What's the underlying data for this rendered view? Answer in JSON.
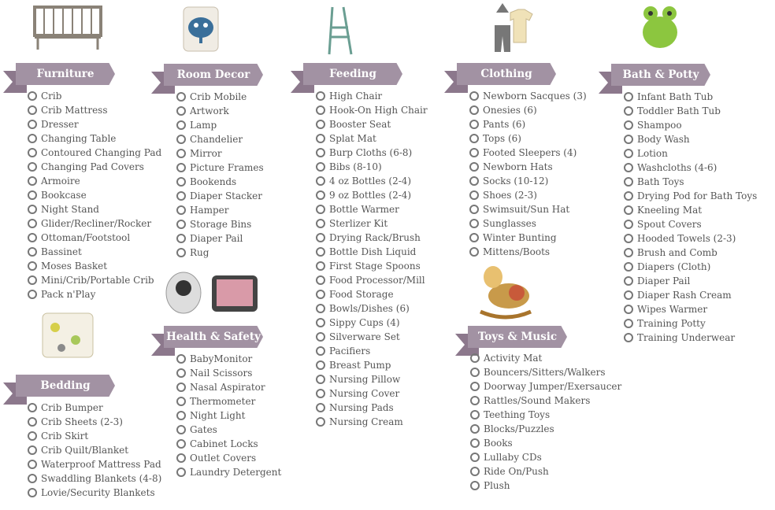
{
  "sections": [
    {
      "title": "Furniture",
      "items": [
        "Crib",
        "Crib Mattress",
        "Dresser",
        "Changing Table",
        "Contoured Changing Pad",
        "Changing Pad Covers",
        "Armoire",
        "Bookcase",
        "Night Stand",
        "Glider/Recliner/Rocker",
        "Ottoman/Footstool",
        "Bassinet",
        "Moses Basket",
        "Mini/Crib/Portable Crib",
        "Pack n'Play"
      ]
    },
    {
      "title": "Room Decor",
      "items": [
        "Crib Mobile",
        "Artwork",
        "Lamp",
        "Chandelier",
        "Mirror",
        "Picture Frames",
        "Bookends",
        "Diaper Stacker",
        "Hamper",
        "Storage Bins",
        "Diaper Pail",
        "Rug"
      ]
    },
    {
      "title": "Feeding",
      "items": [
        "High Chair",
        "Hook-On High Chair",
        "Booster Seat",
        "Splat Mat",
        "Burp Cloths (6-8)",
        "Bibs (8-10)",
        "4 oz Bottles (2-4)",
        "9 oz Bottles (2-4)",
        "Bottle Warmer",
        "Sterlizer Kit",
        "Drying Rack/Brush",
        "Bottle Dish Liquid",
        "First Stage Spoons",
        "Food Processor/Mill",
        "Food Storage",
        "Bowls/Dishes (6)",
        "Sippy Cups (4)",
        "Silverware Set",
        "Pacifiers",
        "Breast Pump",
        "Nursing Pillow",
        "Nursing Cover",
        "Nursing Pads",
        "Nursing Cream"
      ]
    },
    {
      "title": "Clothing",
      "items": [
        "Newborn Sacques (3)",
        "Onesies (6)",
        "Pants (6)",
        "Tops (6)",
        "Footed Sleepers (4)",
        "Newborn Hats",
        "Socks (10-12)",
        "Shoes (2-3)",
        "Swimsuit/Sun Hat",
        "Sunglasses",
        "Winter Bunting",
        "Mittens/Boots"
      ]
    },
    {
      "title": "Bath & Potty",
      "items": [
        "Infant Bath Tub",
        "Toddler Bath Tub",
        "Shampoo",
        "Body Wash",
        "Lotion",
        "Washcloths (4-6)",
        "Bath Toys",
        "Drying Pod for Bath Toys",
        "Kneeling Mat",
        "Spout Covers",
        "Hooded Towels (2-3)",
        "Brush and Comb",
        "Diapers (Cloth)",
        "Diaper Pail",
        "Diaper Rash Cream",
        "Wipes Warmer",
        "Training Potty",
        "Training Underwear"
      ]
    },
    {
      "title": "Bedding",
      "items": [
        "Crib Bumper",
        "Crib Sheets (2-3)",
        "Crib Skirt",
        "Crib Quilt/Blanket",
        "Waterproof Mattress Pad",
        "Swaddling Blankets (4-8)",
        "Lovie/Security Blankets"
      ]
    },
    {
      "title": "Health & Safety",
      "items": [
        "BabyMonitor",
        "Nail Scissors",
        "Nasal Aspirator",
        "Thermometer",
        "Night Light",
        "Gates",
        "Cabinet Locks",
        "Outlet Covers",
        "Laundry Detergent"
      ]
    },
    {
      "title": "Toys & Music",
      "items": [
        "Activity Mat",
        "Bouncers/Sitters/Walkers",
        "Doorway Jumper/Exersaucer",
        "Rattles/Sound Makers",
        "Teething Toys",
        "Blocks/Puzzles",
        "Books",
        "Lullaby CDs",
        "Ride On/Push",
        "Plush"
      ]
    }
  ],
  "colors": {
    "banner": "#a292a3",
    "banner_tail": "#8c788c",
    "text": "#555555"
  }
}
